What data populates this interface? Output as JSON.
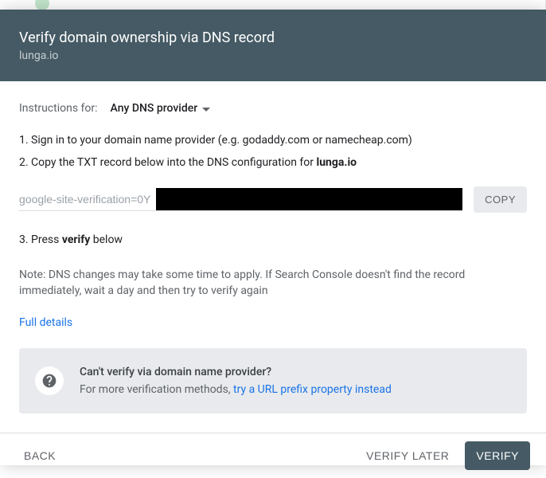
{
  "header": {
    "title": "Verify domain ownership via DNS record",
    "domain": "lunga.io"
  },
  "instructions": {
    "label": "Instructions for:",
    "provider": "Any DNS provider"
  },
  "steps": {
    "s1": "1. Sign in to your domain name provider (e.g. godaddy.com or namecheap.com)",
    "s2_prefix": "2. Copy the TXT record below into the DNS configuration for ",
    "s2_domain": "lunga.io",
    "s3_prefix": "3. Press ",
    "s3_bold": "verify",
    "s3_suffix": " below"
  },
  "txt_record": {
    "value": "google-site-verification=0Y",
    "copy_label": "COPY"
  },
  "note": "Note: DNS changes may take some time to apply. If Search Console doesn't find the record immediately, wait a day and then try to verify again",
  "full_details": "Full details",
  "hint": {
    "question": "Can't verify via domain name provider?",
    "sub_prefix": "For more verification methods, ",
    "link": "try a URL prefix property instead"
  },
  "footer": {
    "back": "BACK",
    "later": "VERIFY LATER",
    "verify": "VERIFY"
  }
}
